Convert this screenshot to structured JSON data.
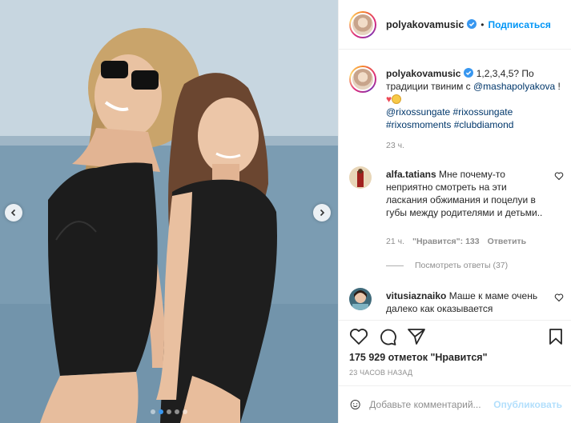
{
  "header": {
    "username": "polyakovamusic",
    "separator": "•",
    "follow_label": "Подписаться"
  },
  "caption": {
    "username": "polyakovamusic",
    "text_part1": " 1,2,3,4,5? По традиции твиним с ",
    "mention": "@mashapolyakova",
    "text_part2": " ! ",
    "hashtags": "@rixossungate #rixossungate #rixosmoments #clubdiamond",
    "time": "23 ч."
  },
  "comments": [
    {
      "username": "alfa.tatians",
      "text": " Мне почему-то неприятно смотреть на эти ласкания обжимания и поцелуи в губы между родителями и детьми..",
      "time": "21 ч.",
      "likes": "\"Нравится\": 133",
      "reply_label": "Ответить",
      "view_replies": "Посмотреть ответы (37)"
    },
    {
      "username": "vitusiaznaiko",
      "text": " Маше к маме очень далеко как оказывается"
    }
  ],
  "post": {
    "likes_text": "175 929 отметок \"Нравится\"",
    "timestamp": "23 ЧАСОВ НАЗАД"
  },
  "comment_box": {
    "placeholder": "Добавьте комментарий...",
    "publish_label": "Опубликовать"
  },
  "carousel": {
    "total_slides": 5,
    "active_slide": 2
  },
  "colors": {
    "accent": "#0095f6",
    "link": "#00376b",
    "muted": "#8e8e8e",
    "publish_disabled": "#b2dffc",
    "active_dot": "#3897f0"
  },
  "icons": {
    "verified": "verified-badge-icon",
    "like": "heart-icon",
    "comment": "comment-bubble-icon",
    "share": "paper-plane-icon",
    "save": "bookmark-icon",
    "emoji": "smiley-icon",
    "prev": "chevron-left-icon",
    "next": "chevron-right-icon"
  }
}
